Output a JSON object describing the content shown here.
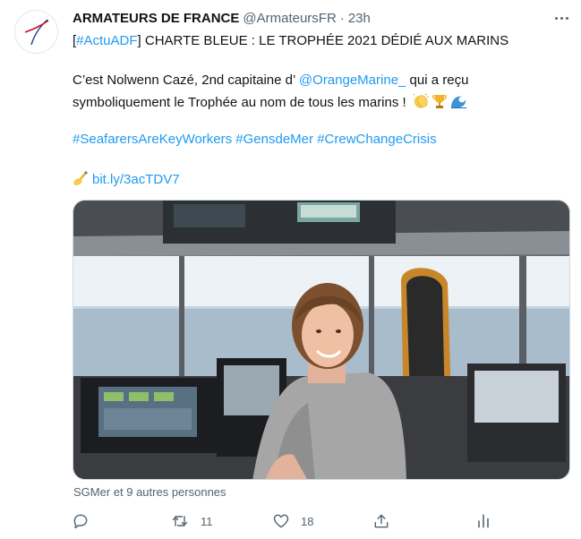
{
  "tweet": {
    "display_name": "ARMATEURS DE FRANCE",
    "handle": "@ArmateursFR",
    "separator": "·",
    "time": "23h",
    "line1": {
      "open_bracket": "[",
      "hashtag": "#ActuADF",
      "rest": "] CHARTE BLEUE : LE TROPHÉE 2021 DÉDIÉ AUX MARINS"
    },
    "line2": {
      "before": "C’est Nolwenn Cazé, 2nd capitaine d’ ",
      "mention": "@OrangeMarine_",
      "after": "  qui a reçu"
    },
    "line3": {
      "text": "symboliquement le Trophée au nom de tous les marins !"
    },
    "hashtags": [
      "#SeafarersAreKeyWorkers",
      "#GensdeMer",
      "#CrewChangeCrisis"
    ],
    "link": "bit.ly/3acTDV7",
    "tagged": "SGMer et 9 autres personnes",
    "actions": {
      "reply_count": "",
      "retweet_count": "11",
      "like_count": "18",
      "share_count": ""
    }
  },
  "icons": {
    "avatar": "armateurs-logo",
    "emoji_line3": [
      "clapping-hands-icon",
      "trophy-icon",
      "wave-icon"
    ],
    "emoji_link": "writing-hand-icon",
    "actions": [
      "reply-icon",
      "retweet-icon",
      "like-icon",
      "share-icon",
      "analytics-icon"
    ]
  },
  "colors": {
    "link": "#1d9bf0",
    "text": "#0f1419",
    "secondary": "#536471"
  }
}
